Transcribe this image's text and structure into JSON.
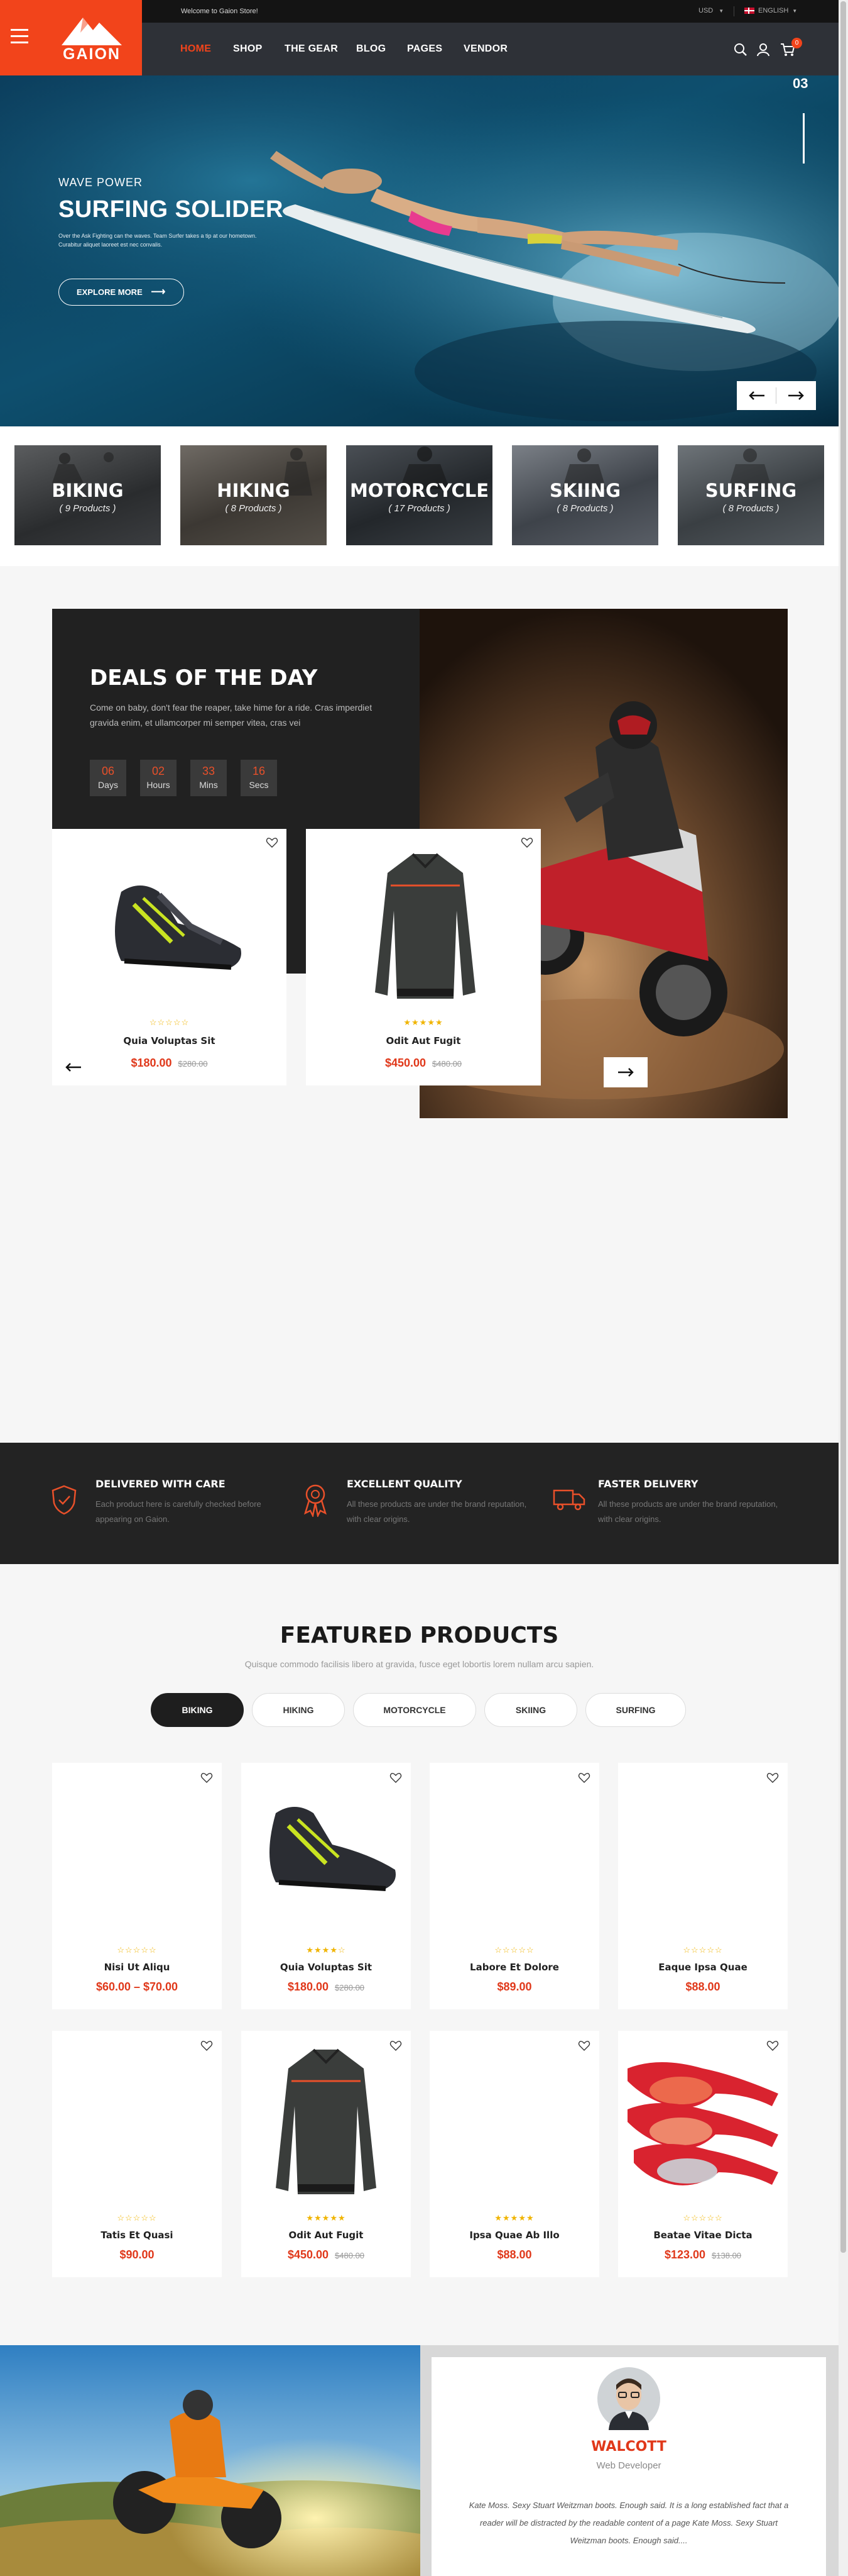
{
  "topbar": {
    "welcome": "Welcome to Gaion Store!",
    "currency": "USD",
    "language": "ENGLISH"
  },
  "brand": {
    "name": "GAION",
    "accent": "#f2441b"
  },
  "nav": {
    "items": [
      "HOME",
      "SHOP",
      "THE GEAR",
      "BLOG",
      "PAGES",
      "VENDOR"
    ],
    "active": "HOME",
    "cart_count": "0"
  },
  "hero": {
    "slide_number": "03",
    "kicker": "WAVE POWER",
    "title": "SURFING SOLIDER",
    "desc_line1": "Over the Ask Fighting can the waves. Team Surfer takes a tip at our hometown.",
    "desc_line2": "Curabitur aliquet laoreet est nec convalis.",
    "cta": "EXPLORE MORE"
  },
  "categories": [
    {
      "name": "BIKING",
      "count": "( 9 Products )"
    },
    {
      "name": "HIKING",
      "count": "( 8 Products )"
    },
    {
      "name": "MOTORCYCLE",
      "count": "( 17 Products )"
    },
    {
      "name": "SKIING",
      "count": "( 8 Products )"
    },
    {
      "name": "SURFING",
      "count": "( 8 Products )"
    }
  ],
  "deals": {
    "title": "DEALS OF THE DAY",
    "desc": "Come on baby, don't fear the reaper, take hime for a ride. Cras imperdiet gravida enim, et ullamcorper mi semper vitea, cras vei",
    "countdown": [
      {
        "value": "06",
        "label": "Days"
      },
      {
        "value": "02",
        "label": "Hours"
      },
      {
        "value": "33",
        "label": "Mins"
      },
      {
        "value": "16",
        "label": "Secs"
      }
    ],
    "products": [
      {
        "name": "Quia Voluptas Sit",
        "price": "$180.00",
        "old_price": "$280.00",
        "rating": 0
      },
      {
        "name": "Odit Aut Fugit",
        "price": "$450.00",
        "old_price": "$480.00",
        "rating": 5
      }
    ]
  },
  "features": [
    {
      "title": "DELIVERED WITH CARE",
      "text": "Each product here is carefully checked before appearing on Gaion.",
      "icon": "shield-check-icon"
    },
    {
      "title": "EXCELLENT QUALITY",
      "text": "All these products are under the brand reputation, with clear origins.",
      "icon": "award-ribbon-icon"
    },
    {
      "title": "FASTER DELIVERY",
      "text": "All these products are under the brand reputation, with clear origins.",
      "icon": "delivery-truck-icon"
    }
  ],
  "featured": {
    "title": "FEATURED PRODUCTS",
    "subtitle": "Quisque commodo facilisis libero at gravida, fusce eget lobortis lorem nullam arcu sapien.",
    "tabs": [
      "BIKING",
      "HIKING",
      "MOTORCYCLE",
      "SKIING",
      "SURFING"
    ],
    "active_tab": "BIKING",
    "products": [
      {
        "name": "Nisi Ut Aliqu",
        "price": "$60.00 – $70.00",
        "old_price": "",
        "rating": 0
      },
      {
        "name": "Quia Voluptas Sit",
        "price": "$180.00",
        "old_price": "$280.00",
        "rating": 4
      },
      {
        "name": "Labore Et Dolore",
        "price": "$89.00",
        "old_price": "",
        "rating": 0
      },
      {
        "name": "Eaque Ipsa Quae",
        "price": "$88.00",
        "old_price": "",
        "rating": 0
      },
      {
        "name": "Tatis Et Quasi",
        "price": "$90.00",
        "old_price": "",
        "rating": 0
      },
      {
        "name": "Odit Aut Fugit",
        "price": "$450.00",
        "old_price": "$480.00",
        "rating": 5
      },
      {
        "name": "Ipsa Quae Ab Illo",
        "price": "$88.00",
        "old_price": "",
        "rating": 5
      },
      {
        "name": "Beatae Vitae Dicta",
        "price": "$123.00",
        "old_price": "$138.00",
        "rating": 0
      }
    ]
  },
  "testimonial": {
    "name": "WALCOTT",
    "role": "Web Developer",
    "quote": "Kate Moss. Sexy Stuart Weitzman boots. Enough said. It is a long established fact that a reader will be distracted by the readable content of a page Kate Moss. Sexy Stuart Weitzman boots. Enough said...."
  }
}
